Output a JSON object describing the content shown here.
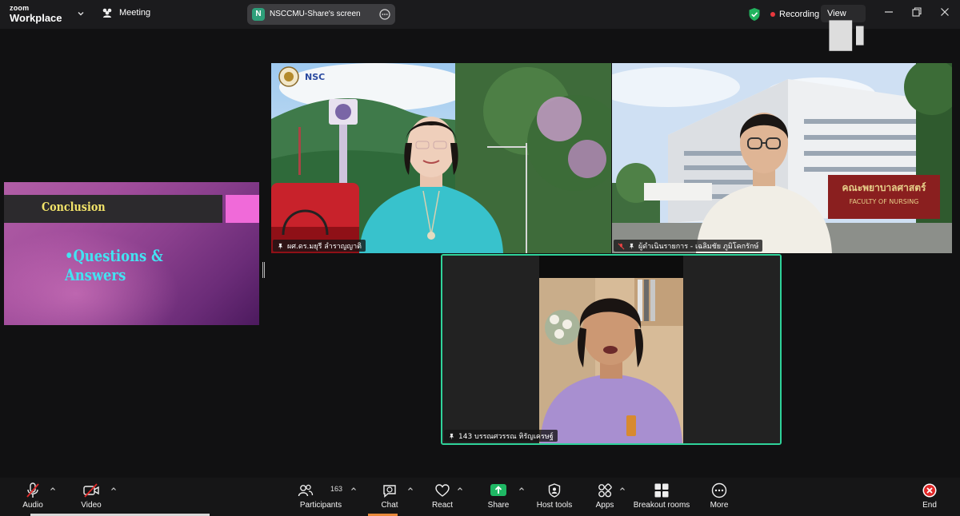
{
  "titlebar": {
    "logo_top": "zoom",
    "logo_bottom": "Workplace",
    "meeting_label": "Meeting",
    "share_initial": "N",
    "share_label": "NSCCMU-Share's screen",
    "recording_label": "Recording",
    "view_label": "View"
  },
  "slide": {
    "title": "Conclusion",
    "bullet": "•Questions & Answers"
  },
  "participants": [
    {
      "name": "ผศ.ดร.มยุรี ลำราญญาติ",
      "logo_text": "NSC"
    },
    {
      "name": "ผู้ดำเนินรายการ - เฉลิมชัย  ภูมิโคกรักษ์",
      "sign_text": "คณะพยาบาลศาสตร์",
      "sign_sub": "FACULTY OF NURSING"
    },
    {
      "name": "143 บรรณศวรรณ หิรัญเครษฐ์"
    }
  ],
  "toolbar": {
    "audio": "Audio",
    "video": "Video",
    "participants": "Participants",
    "participants_count": "163",
    "chat": "Chat",
    "react": "React",
    "share": "Share",
    "host_tools": "Host tools",
    "apps": "Apps",
    "breakout": "Breakout rooms",
    "more": "More",
    "end": "End"
  },
  "colors": {
    "accent_green": "#2fd39a",
    "share_green": "#1fb864",
    "recording_red": "#e8383d",
    "end_red": "#e02828"
  }
}
